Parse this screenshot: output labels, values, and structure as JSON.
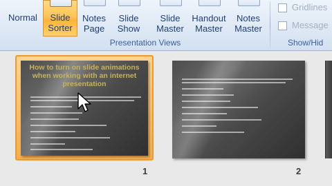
{
  "ribbon": {
    "presentation_views": {
      "group_label": "Presentation Views",
      "buttons": [
        {
          "line1": "Normal",
          "line2": ""
        },
        {
          "line1": "Slide",
          "line2": "Sorter"
        },
        {
          "line1": "Notes",
          "line2": "Page"
        },
        {
          "line1": "Slide",
          "line2": "Show"
        },
        {
          "line1": "Slide",
          "line2": "Master"
        },
        {
          "line1": "Handout",
          "line2": "Master"
        },
        {
          "line1": "Notes",
          "line2": "Master"
        }
      ]
    },
    "show_hide": {
      "group_label": "Show/Hid",
      "gridlines": "Gridlines",
      "message_bar": "Message"
    }
  },
  "slides": [
    {
      "number": "1",
      "title": "How to turn on slide animations when working with an internet presentation",
      "selected": true
    },
    {
      "number": "2",
      "title": "",
      "selected": false
    }
  ],
  "colors": {
    "selection_orange": "#f7ad4d",
    "ribbon_blue": "#dde8f5",
    "slide_title_gold": "#c8b25a"
  }
}
